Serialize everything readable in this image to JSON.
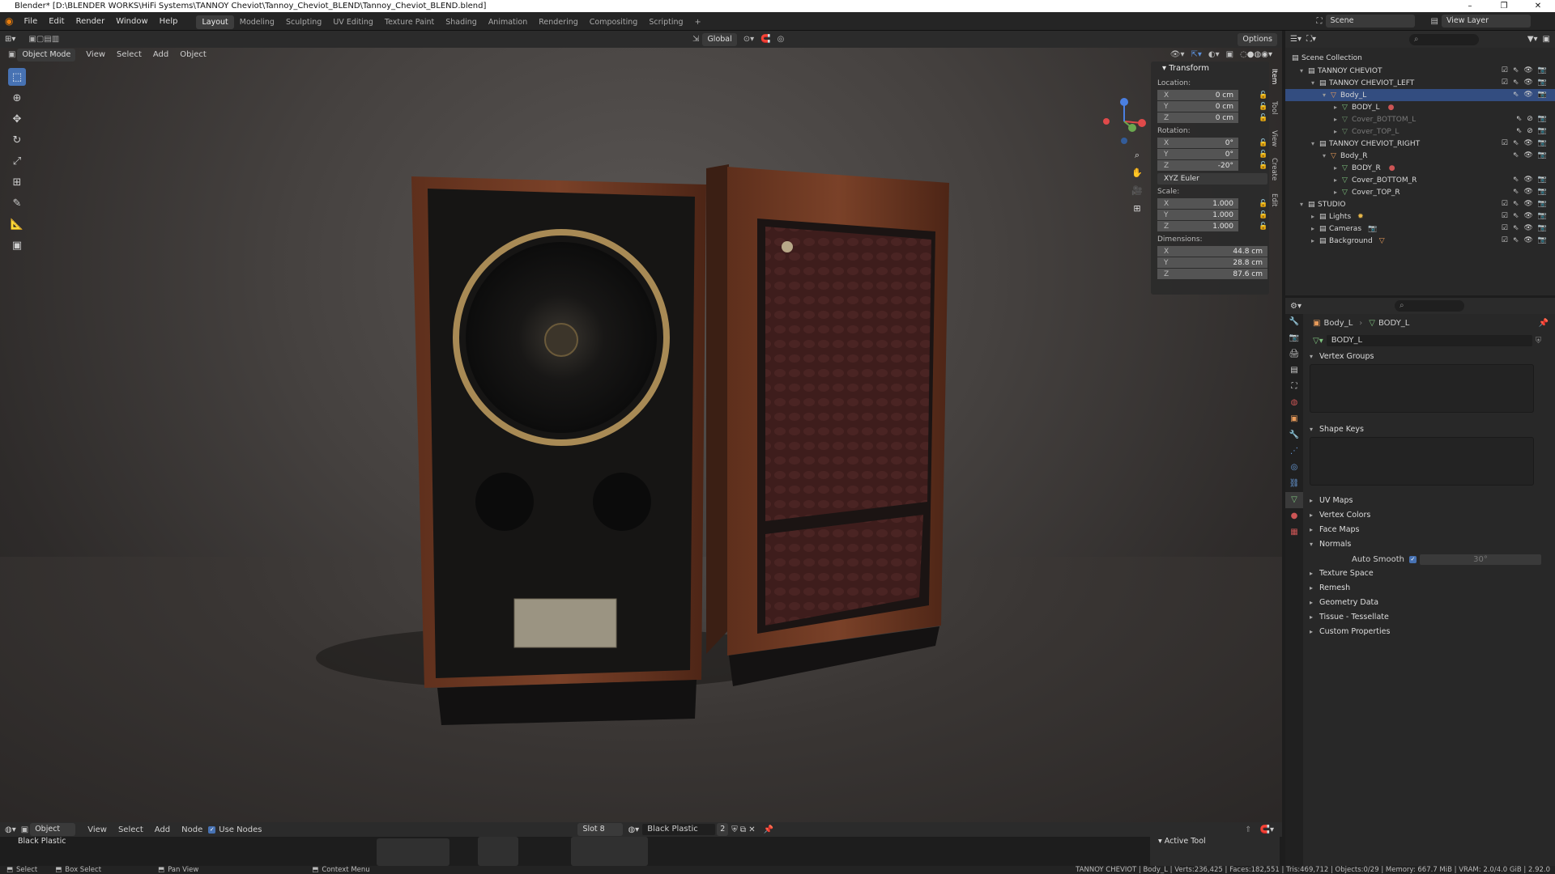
{
  "titlebar": {
    "title": "Blender* [D:\\BLENDER WORKS\\HiFi Systems\\TANNOY Cheviot\\Tannoy_Cheviot_BLEND\\Tannoy_Cheviot_BLEND.blend]",
    "minimize": "–",
    "maximize": "❐",
    "close": "✕"
  },
  "menu": {
    "items": [
      "File",
      "Edit",
      "Render",
      "Window",
      "Help"
    ]
  },
  "workspaces": {
    "active": "Layout",
    "items": [
      "Layout",
      "Modeling",
      "Sculpting",
      "UV Editing",
      "Texture Paint",
      "Shading",
      "Animation",
      "Rendering",
      "Compositing",
      "Scripting"
    ],
    "add": "+"
  },
  "scene": {
    "label": "Scene",
    "view_layer": "View Layer"
  },
  "viewport": {
    "orientation": "Global",
    "options": "Options",
    "mode": "Object Mode",
    "menus": [
      "View",
      "Select",
      "Add",
      "Object"
    ]
  },
  "gizmo": {
    "x": "X",
    "y": "Y",
    "z": "Z"
  },
  "npanel": {
    "title": "Transform",
    "location_label": "Location:",
    "location": [
      "0 cm",
      "0 cm",
      "0 cm"
    ],
    "rotation_label": "Rotation:",
    "rotation": [
      "0°",
      "0°",
      "-20°"
    ],
    "rotation_mode": "XYZ Euler",
    "scale_label": "Scale:",
    "scale": [
      "1.000",
      "1.000",
      "1.000"
    ],
    "dimensions_label": "Dimensions:",
    "dimensions": [
      "44.8 cm",
      "28.8 cm",
      "87.6 cm"
    ],
    "axes": [
      "X",
      "Y",
      "Z"
    ],
    "tabs": [
      "Item",
      "Tool",
      "View",
      "Create",
      "Edit"
    ]
  },
  "outliner": {
    "rows": [
      {
        "name": "Scene Collection",
        "indent": 0
      },
      {
        "name": "TANNOY CHEVIOT",
        "indent": 1
      },
      {
        "name": "TANNOY CHEVIOT_LEFT",
        "indent": 2
      },
      {
        "name": "Body_L",
        "indent": 3
      },
      {
        "name": "BODY_L",
        "indent": 4
      },
      {
        "name": "Cover_BOTTOM_L",
        "indent": 4
      },
      {
        "name": "Cover_TOP_L",
        "indent": 4
      },
      {
        "name": "TANNOY CHEVIOT_RIGHT",
        "indent": 2
      },
      {
        "name": "Body_R",
        "indent": 3
      },
      {
        "name": "BODY_R",
        "indent": 4
      },
      {
        "name": "Cover_BOTTOM_R",
        "indent": 4
      },
      {
        "name": "Cover_TOP_R",
        "indent": 4
      },
      {
        "name": "STUDIO",
        "indent": 1
      },
      {
        "name": "Lights",
        "indent": 2
      },
      {
        "name": "Cameras",
        "indent": 2
      },
      {
        "name": "Background",
        "indent": 2
      }
    ]
  },
  "properties": {
    "object": "Body_L",
    "mesh": "BODY_L",
    "datablock": "BODY_L",
    "sections": {
      "vertex_groups": "Vertex Groups",
      "shape_keys": "Shape Keys",
      "uv_maps": "UV Maps",
      "vertex_colors": "Vertex Colors",
      "face_maps": "Face Maps",
      "normals": "Normals",
      "auto_smooth": "Auto Smooth",
      "auto_smooth_angle": "30°",
      "texture_space": "Texture Space",
      "remesh": "Remesh",
      "geometry_data": "Geometry Data",
      "tissue": "Tissue - Tessellate",
      "custom_props": "Custom Properties"
    }
  },
  "shader_editor": {
    "type": "Object",
    "menus": [
      "View",
      "Select",
      "Add",
      "Node"
    ],
    "use_nodes": "Use Nodes",
    "slot": "Slot 8",
    "material": "Black Plastic",
    "users": "2",
    "breadcrumb": "Black Plastic"
  },
  "active_tool": {
    "title": "Active Tool"
  },
  "statusbar": {
    "select": "Select",
    "box_select": "Box Select",
    "pan_view": "Pan View",
    "context_menu": "Context Menu",
    "stats": "TANNOY CHEVIOT | Body_L | Verts:236,425 | Faces:182,551 | Tris:469,712 | Objects:0/29 | Memory: 667.7 MiB | VRAM: 2.0/4.0 GiB | 2.92.0"
  }
}
